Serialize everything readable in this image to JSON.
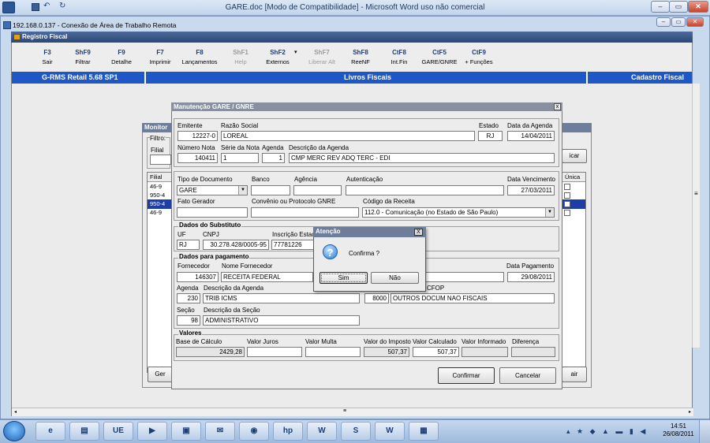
{
  "word": {
    "title": "GARE.doc [Modo de Compatibilidade] - Microsoft Word uso não comercial",
    "min": "‒",
    "max": "▭",
    "close": "✕"
  },
  "rdp": {
    "title": "192.168.0.137 - Conexão de Área de Trabalho Remota"
  },
  "app": {
    "title": "Registro Fiscal"
  },
  "toolbar": [
    {
      "key": "F3",
      "label": "Sair",
      "enabled": true
    },
    {
      "key": "ShF9",
      "label": "Filtrar",
      "enabled": true
    },
    {
      "key": "F9",
      "label": "Detalhe",
      "enabled": true
    },
    {
      "key": "F7",
      "label": "Imprimir",
      "enabled": true
    },
    {
      "key": "F8",
      "label": "Lançamentos",
      "enabled": true
    },
    {
      "key": "ShF1",
      "label": "Help",
      "enabled": false
    },
    {
      "key": "ShF2",
      "label": "Externos",
      "enabled": true
    },
    {
      "key": "ShF7",
      "label": "Liberar Alt",
      "enabled": false
    },
    {
      "key": "ShF8",
      "label": "ReeNF",
      "enabled": true
    },
    {
      "key": "CtF8",
      "label": "Int.Fin",
      "enabled": true
    },
    {
      "key": "CtF5",
      "label": "GARE/GNRE",
      "enabled": true
    },
    {
      "key": "CtF9",
      "label": "+ Funções",
      "enabled": true
    }
  ],
  "status": {
    "version": "G-RMS Retail 5.68 SP1",
    "module": "Livros Fiscais",
    "screen": "Cadastro Fiscal"
  },
  "monitor": {
    "title": "Monitor",
    "filter_label": "Filtro:",
    "filial_label": "Filial",
    "grid_header": "Filial",
    "unica_header": "Única",
    "rows": [
      "46-9",
      "950-4",
      "950-4",
      "46-9"
    ],
    "selected_row": 2,
    "btn_right": "icar",
    "btn_left": "Ger",
    "btn_right_bottom": "air"
  },
  "dialog": {
    "title": "Manutenção GARE / GNRE",
    "close": "x",
    "emitente": {
      "label": "Emitente",
      "value": "12227-0"
    },
    "razao": {
      "label": "Razão Social",
      "value": "LOREAL"
    },
    "estado": {
      "label": "Estado",
      "value": "RJ"
    },
    "data_agenda": {
      "label": "Data da Agenda",
      "value": "14/04/2011"
    },
    "numero_nota": {
      "label": "Número Nota",
      "value": "140411"
    },
    "serie_nota": {
      "label": "Série da Nota",
      "value": "1"
    },
    "agenda": {
      "label": "Agenda",
      "value": "1"
    },
    "desc_agenda": {
      "label": "Descrição da Agenda",
      "value": "CMP MERC REV ADQ TERC - EDI"
    },
    "tipo_doc": {
      "label": "Tipo de Documento",
      "value": "GARE"
    },
    "banco": {
      "label": "Banco",
      "value": ""
    },
    "agencia": {
      "label": "Agência",
      "value": ""
    },
    "autenticacao": {
      "label": "Autenticação",
      "value": ""
    },
    "data_venc": {
      "label": "Data Vencimento",
      "value": "27/03/2011"
    },
    "fato_gerador": {
      "label": "Fato Gerador",
      "value": ""
    },
    "convenio": {
      "label": "Convênio ou Protocolo GNRE",
      "value": ""
    },
    "cod_receita": {
      "label": "Código da Receita",
      "value": "112.0 - Comunicação (no Estado de São Paulo)"
    },
    "substituto": {
      "group": "Dados do Substituto",
      "uf_label": "UF",
      "uf": "RJ",
      "cnpj_label": "CNPJ",
      "cnpj": "30.278.428/0005-95",
      "ie_label": "Inscrição Estad",
      "ie": "77781226"
    },
    "pagamento": {
      "group": "Dados para pagamento",
      "fornecedor_label": "Fornecedor",
      "fornecedor": "146307",
      "nome_label": "Nome Fornecedor",
      "nome": "RECEITA FEDERAL",
      "data_pag_label": "Data Pagamento",
      "data_pag": "29/08/2011",
      "agenda_label": "Agenda",
      "agenda": "230",
      "desc_agenda_label": "Descrição da Agenda",
      "desc_agenda": "TRIB ICMS",
      "cfop_label": "CFOP",
      "cfop_code": "8000",
      "cfop_desc": "OUTROS DOCUM NAO FISCAIS",
      "secao_label": "Seção",
      "secao": "98",
      "desc_secao_label": "Descrição da Seção",
      "desc_secao": "ADMINISTRATIVO"
    },
    "valores": {
      "group": "Valores",
      "base_label": "Base de Cálculo",
      "base": "2429,28",
      "juros_label": "Valor Juros",
      "juros": "",
      "multa_label": "Valor Multa",
      "multa": "",
      "imposto_label": "Valor do Imposto",
      "imposto": "507,37",
      "calculado_label": "Valor Calculado",
      "calculado": "507,37",
      "informado_label": "Valor Informado",
      "informado": "",
      "diferenca_label": "Diferença",
      "diferenca": ""
    },
    "confirm_btn": "Confirmar",
    "cancel_btn": "Cancelar"
  },
  "alert": {
    "title": "Atenção",
    "close": "X",
    "message": "Confirma ?",
    "yes": "Sim",
    "no": "Não"
  },
  "taskbar": {
    "time": "14:51",
    "date": "26/08/2011",
    "apps": [
      "e",
      "▤",
      "UE",
      "▶",
      "▣",
      "✉",
      "◉",
      "hp",
      "W",
      "S",
      "W",
      "▦"
    ]
  }
}
